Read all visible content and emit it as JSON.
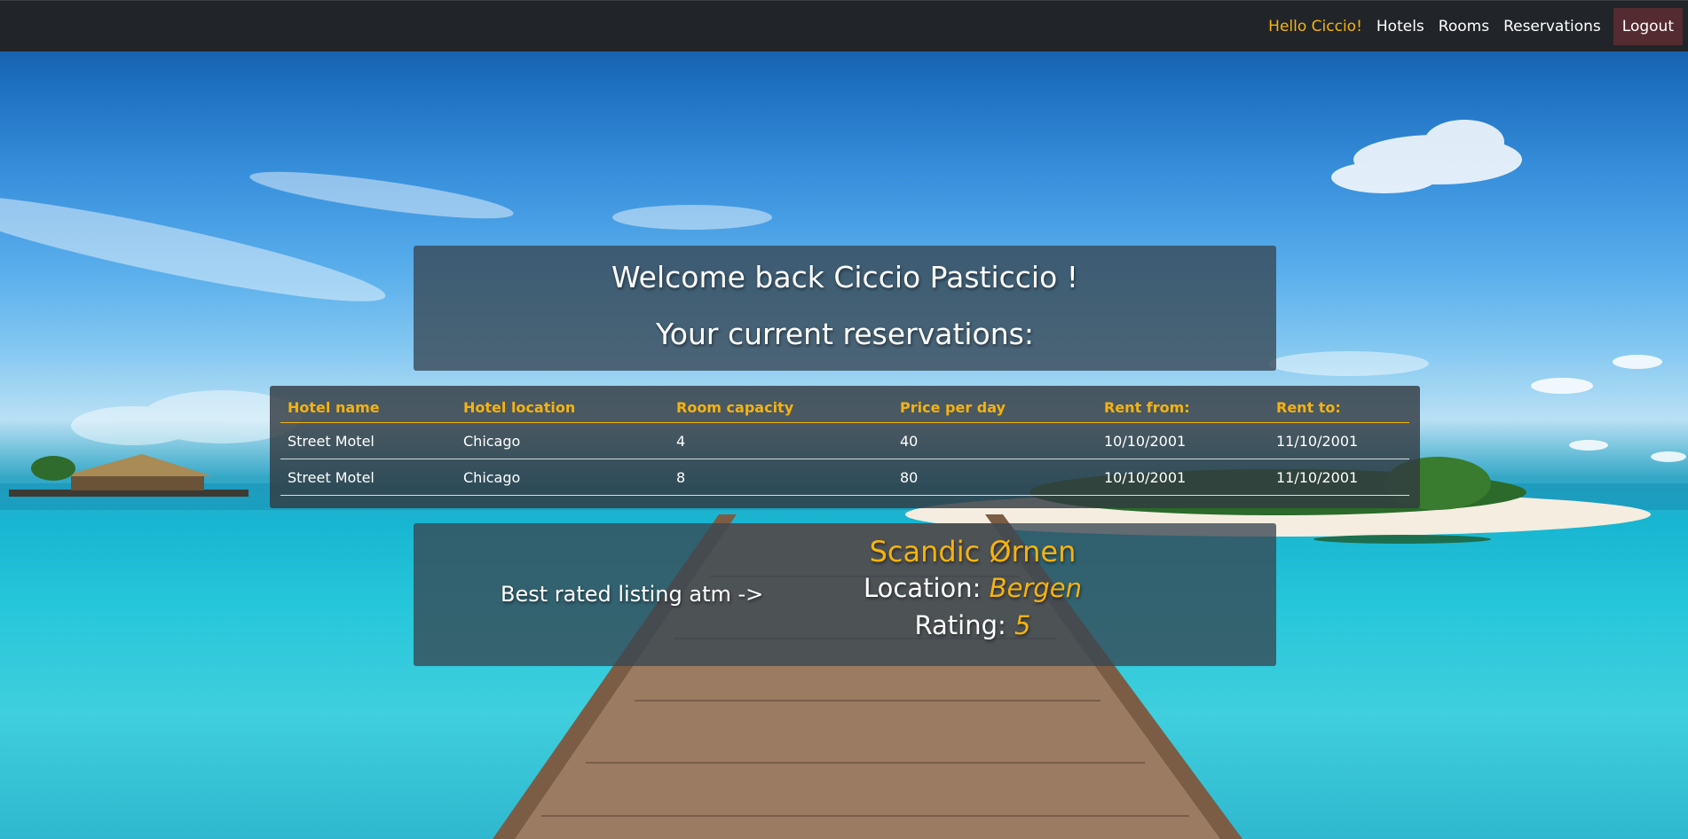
{
  "nav": {
    "greeting": "Hello Ciccio!",
    "links": [
      "Hotels",
      "Rooms",
      "Reservations"
    ],
    "logout": "Logout"
  },
  "welcome": {
    "title": "Welcome back Ciccio Pasticcio !",
    "subtitle": "Your current reservations:"
  },
  "reservations": {
    "headers": [
      "Hotel name",
      "Hotel location",
      "Room capacity",
      "Price per day",
      "Rent from:",
      "Rent to:"
    ],
    "rows": [
      [
        "Street Motel",
        "Chicago",
        "4",
        "40",
        "10/10/2001",
        "11/10/2001"
      ],
      [
        "Street Motel",
        "Chicago",
        "8",
        "80",
        "10/10/2001",
        "11/10/2001"
      ]
    ]
  },
  "best_listing": {
    "label": "Best rated listing atm ->",
    "hotel_name": "Scandic Ørnen",
    "location_label": "Location:",
    "location_value": "Bergen",
    "rating_label": "Rating:",
    "rating_value": "5"
  },
  "colors": {
    "accent": "#f5b30f",
    "navbar": "#212529",
    "logout_bg": "#542b30"
  }
}
